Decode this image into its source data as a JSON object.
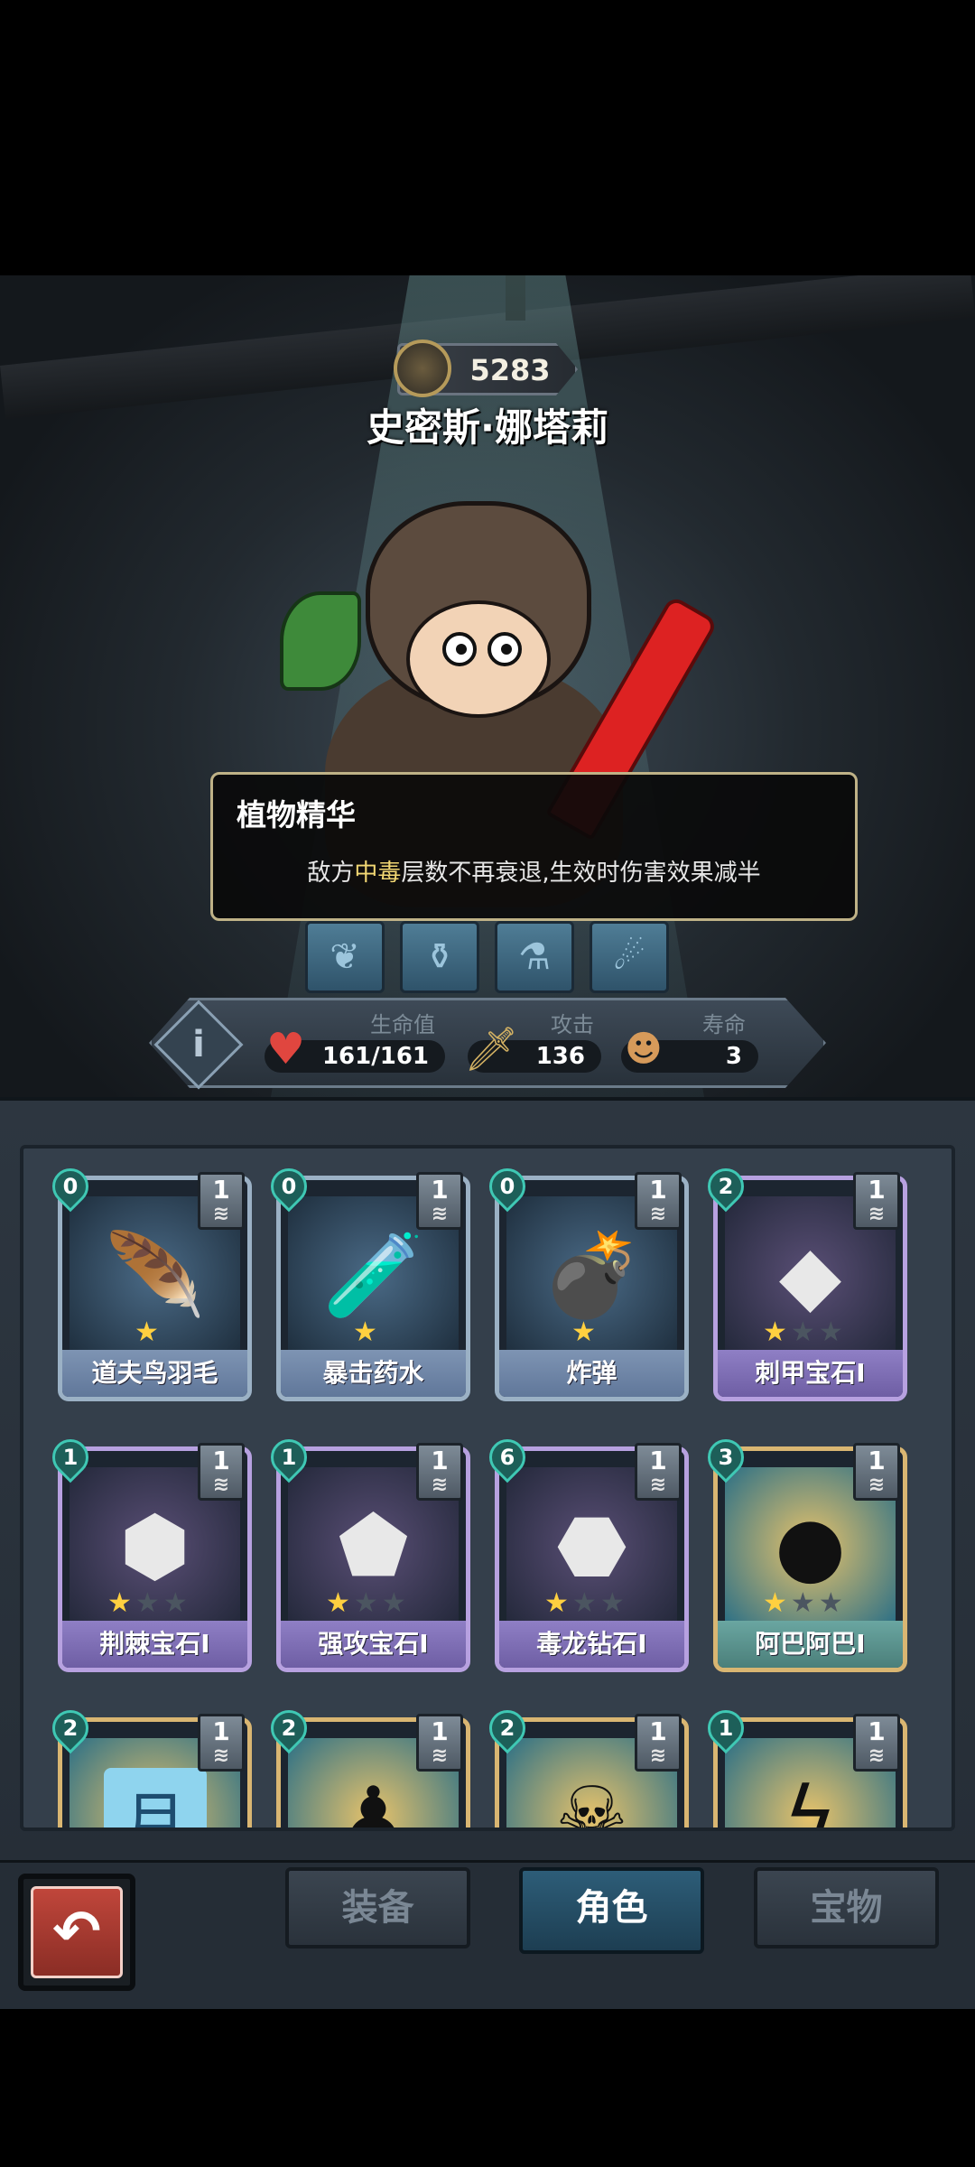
{
  "character": {
    "power": "5283",
    "name": "史密斯·娜塔莉"
  },
  "tooltip": {
    "title": "植物精华",
    "desc_prefix": "敌方",
    "desc_highlight": "中毒",
    "desc_suffix": "层数不再衰退,生效时伤害效果减半"
  },
  "stats": {
    "hp_label": "生命值",
    "hp_value": "161/161",
    "atk_label": "攻击",
    "atk_value": "136",
    "life_label": "寿命",
    "life_value": "3",
    "info_glyph": "i"
  },
  "cards": [
    {
      "name": "道夫鸟羽毛",
      "cost": "0",
      "level": "1",
      "stars_on": 1,
      "stars_total": 1,
      "rarity": "blue",
      "icon": "feather-icon"
    },
    {
      "name": "暴击药水",
      "cost": "0",
      "level": "1",
      "stars_on": 1,
      "stars_total": 1,
      "rarity": "blue",
      "icon": "potion-icon"
    },
    {
      "name": "炸弹",
      "cost": "0",
      "level": "1",
      "stars_on": 1,
      "stars_total": 1,
      "rarity": "blue",
      "icon": "bomb-icon"
    },
    {
      "name": "刺甲宝石I",
      "cost": "2",
      "level": "1",
      "stars_on": 1,
      "stars_total": 3,
      "rarity": "purple",
      "icon": "spike-gem-icon"
    },
    {
      "name": "荆棘宝石I",
      "cost": "1",
      "level": "1",
      "stars_on": 1,
      "stars_total": 3,
      "rarity": "purple",
      "icon": "thorn-gem-icon"
    },
    {
      "name": "强攻宝石I",
      "cost": "1",
      "level": "1",
      "stars_on": 1,
      "stars_total": 3,
      "rarity": "purple",
      "icon": "attack-gem-icon"
    },
    {
      "name": "毒龙钻石I",
      "cost": "6",
      "level": "1",
      "stars_on": 1,
      "stars_total": 3,
      "rarity": "purple",
      "icon": "poison-diamond-icon"
    },
    {
      "name": "阿巴阿巴I",
      "cost": "3",
      "level": "1",
      "stars_on": 1,
      "stars_total": 3,
      "rarity": "gold",
      "icon": "shadow-creature-icon"
    },
    {
      "name": "",
      "cost": "2",
      "level": "1",
      "rarity": "gold",
      "icon": "moon-card-icon",
      "art_text": "月"
    },
    {
      "name": "",
      "cost": "2",
      "level": "1",
      "rarity": "gold",
      "icon": "shadow-figure-icon"
    },
    {
      "name": "",
      "cost": "2",
      "level": "1",
      "rarity": "gold",
      "icon": "skull-icon"
    },
    {
      "name": "",
      "cost": "1",
      "level": "1",
      "rarity": "gold",
      "icon": "lightning-icon"
    }
  ],
  "tabs": {
    "equipment": "装备",
    "character": "角色",
    "treasure": "宝物"
  },
  "back_glyph": "↶",
  "colors": {
    "highlight": "#f3d874",
    "star_on": "#ffd040",
    "active_tab": "#2d5d78",
    "back_button": "#c0463b"
  }
}
